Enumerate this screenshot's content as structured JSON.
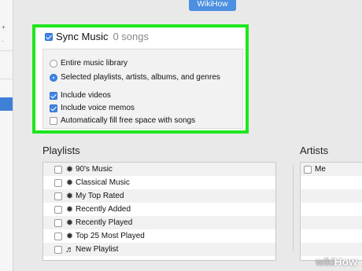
{
  "top_button": "WikiHow",
  "sync": {
    "label": "Sync Music",
    "count": "0 songs",
    "radio_options": [
      {
        "label": "Entire music library",
        "selected": false
      },
      {
        "label": "Selected playlists, artists, albums, and genres",
        "selected": true
      }
    ],
    "checkbox_options": [
      {
        "label": "Include videos",
        "checked": true
      },
      {
        "label": "Include voice memos",
        "checked": true
      },
      {
        "label": "Automatically fill free space with songs",
        "checked": false
      }
    ]
  },
  "playlists": {
    "title": "Playlists",
    "items": [
      {
        "label": "90's Music",
        "icon": "gear-icon"
      },
      {
        "label": "Classical Music",
        "icon": "gear-icon"
      },
      {
        "label": "My Top Rated",
        "icon": "gear-icon"
      },
      {
        "label": "Recently Added",
        "icon": "gear-icon"
      },
      {
        "label": "Recently Played",
        "icon": "gear-icon"
      },
      {
        "label": "Top 25 Most Played",
        "icon": "gear-icon"
      },
      {
        "label": "New Playlist",
        "icon": "playlist-icon"
      }
    ]
  },
  "artists": {
    "title": "Artists",
    "items": [
      {
        "label": "Me"
      }
    ]
  },
  "watermark": {
    "wiki": "wiki",
    "how": "How"
  },
  "colors": {
    "highlight": "#1ee61e",
    "accent": "#3f86e4"
  }
}
